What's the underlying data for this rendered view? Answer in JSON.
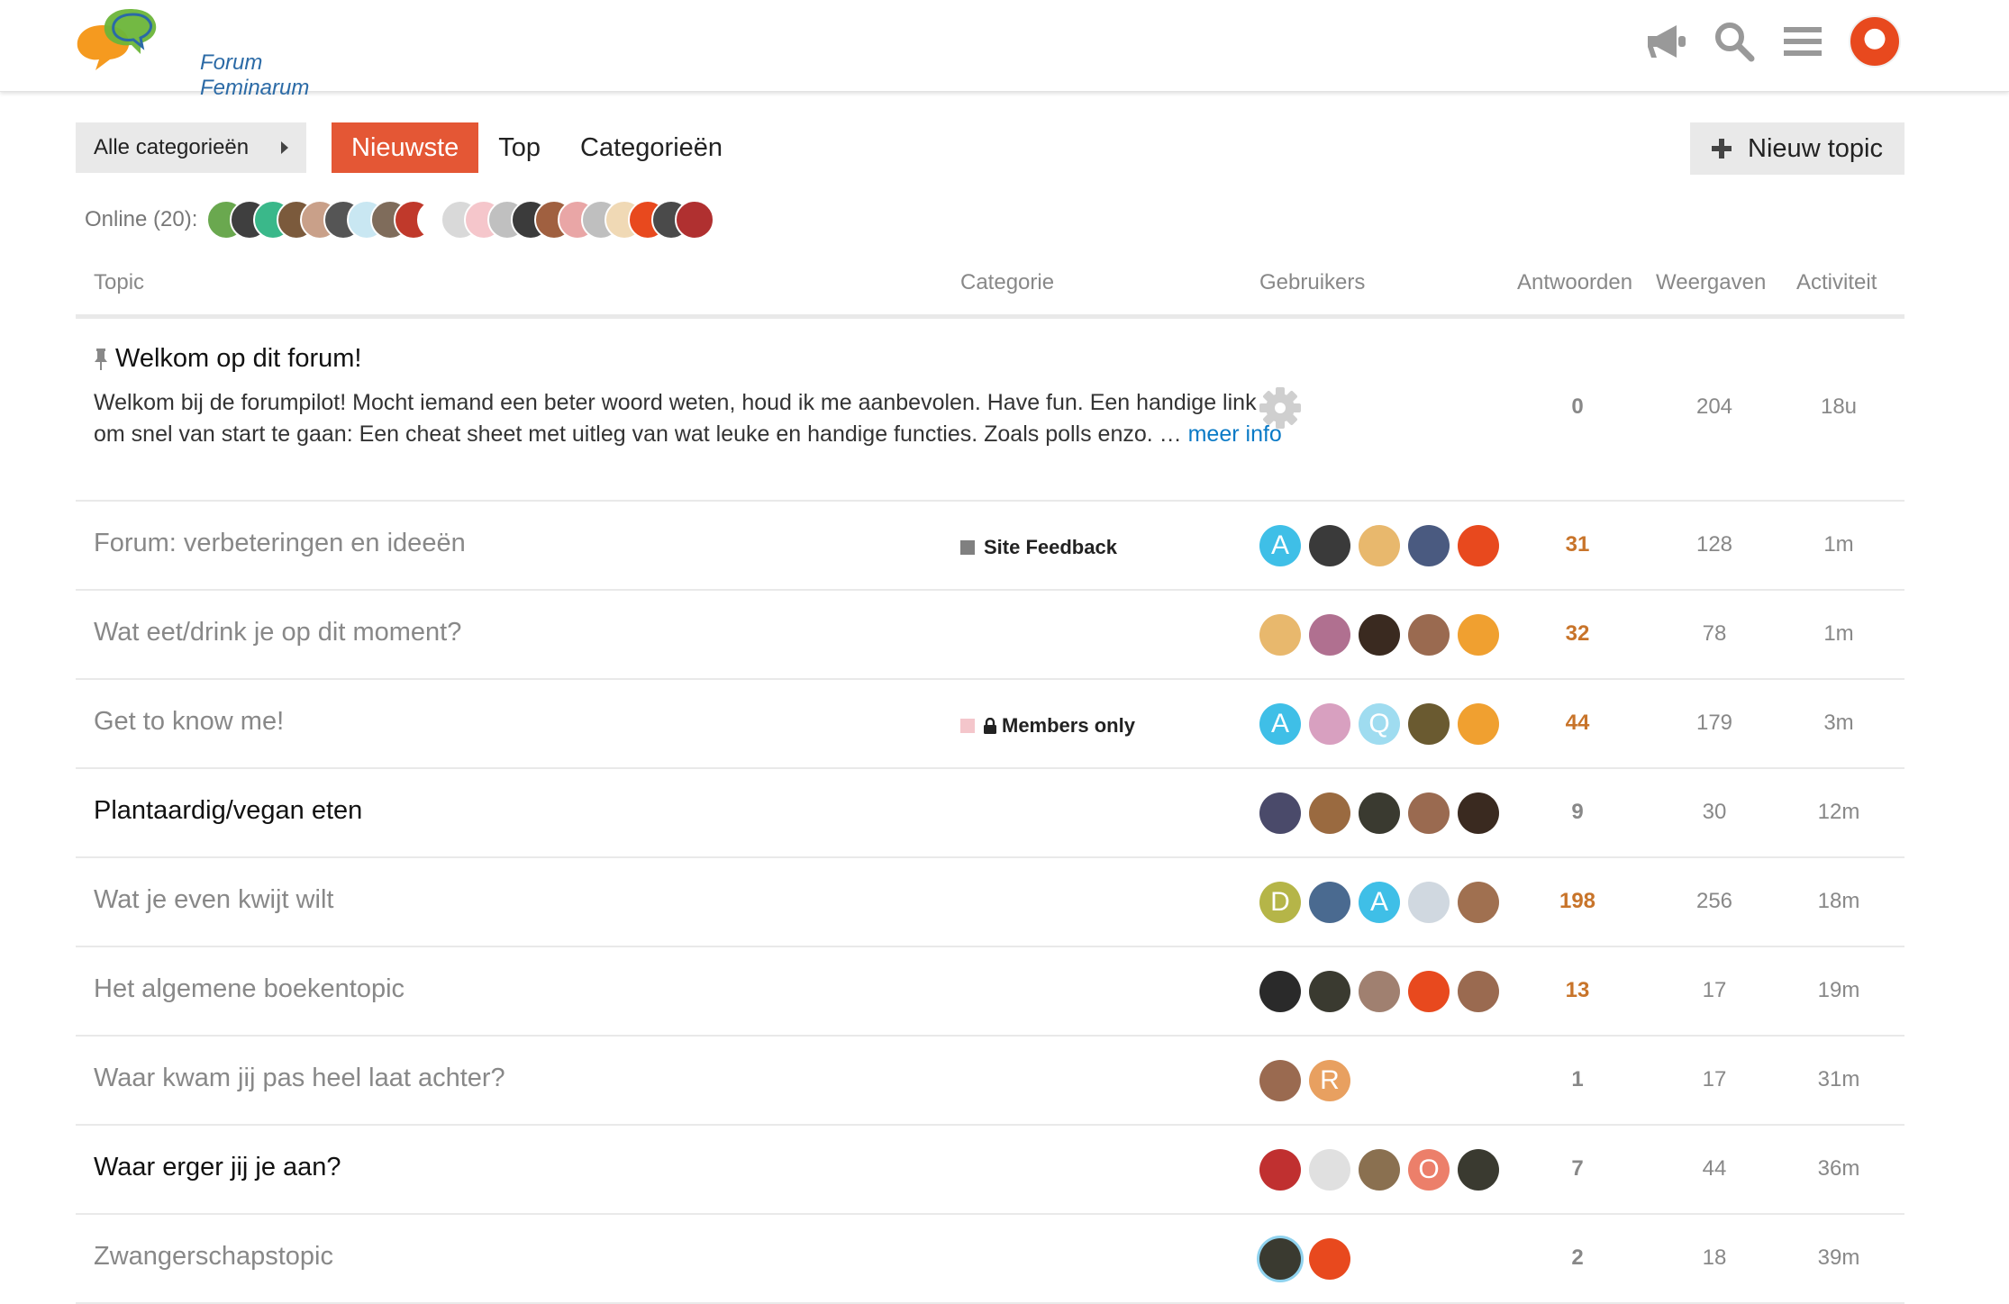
{
  "app": {
    "logo_text": "Forum Feminarum"
  },
  "header_icons": [
    "megaphone-icon",
    "search-icon",
    "hamburger-icon",
    "user-avatar"
  ],
  "nav": {
    "category_dropdown": "Alle categorieën",
    "tabs": [
      {
        "label": "Nieuwste",
        "active": true
      },
      {
        "label": "Top",
        "active": false
      },
      {
        "label": "Categorieën",
        "active": false
      }
    ],
    "new_topic_label": "Nieuw topic"
  },
  "online": {
    "label": "Online (20):",
    "avatar_colors": [
      "#6aa84f",
      "#3f3f3f",
      "#3ab88a",
      "#7b5a3c",
      "#c9a089",
      "#555555",
      "#c9e7f2",
      "#7f6c5b",
      "#c0392b",
      "#ffffff",
      "#d9d9d9",
      "#f5c6cb",
      "#c0c0c0",
      "#3b3b3b",
      "#a06040",
      "#e9a6a6",
      "#bfbfbf",
      "#f0d9b5",
      "#e8491e",
      "#4a4a4a",
      "#b03030"
    ]
  },
  "table": {
    "headers": {
      "topic": "Topic",
      "category": "Categorie",
      "users": "Gebruikers",
      "replies": "Antwoorden",
      "views": "Weergaven",
      "activity": "Activiteit"
    },
    "pinned": {
      "title": "Welkom op dit forum!",
      "excerpt": "Welkom bij de forumpilot! Mocht iemand een beter woord weten, houd ik me aanbevolen. Have fun. Een handige link om snel van start te gaan: Een cheat sheet met uitleg van wat leuke en handige functies. Zoals polls enzo. … ",
      "more_link": "meer info",
      "replies": "0",
      "views": "204",
      "activity": "18u"
    },
    "rows": [
      {
        "title": "Forum: verbeteringen en ideeën",
        "unread": false,
        "category": "Site Feedback",
        "category_color": "#808080",
        "locked": false,
        "users": [
          {
            "letter": "A",
            "color": "#3fbfe7"
          },
          {
            "letter": "",
            "color": "#3a3a3a"
          },
          {
            "letter": "",
            "color": "#e8b86d"
          },
          {
            "letter": "",
            "color": "#4a5a80"
          },
          {
            "letter": "",
            "color": "#e8491e"
          }
        ],
        "replies": "31",
        "hot": true,
        "views": "128",
        "activity": "1m"
      },
      {
        "title": "Wat eet/drink je op dit moment?",
        "unread": false,
        "category": "",
        "category_color": "",
        "locked": false,
        "users": [
          {
            "letter": "",
            "color": "#e8b86d"
          },
          {
            "letter": "",
            "color": "#b07090"
          },
          {
            "letter": "",
            "color": "#3a2a20"
          },
          {
            "letter": "",
            "color": "#9a6a50"
          },
          {
            "letter": "",
            "color": "#f0a030"
          }
        ],
        "replies": "32",
        "hot": true,
        "views": "78",
        "activity": "1m"
      },
      {
        "title": "Get to know me!",
        "unread": false,
        "category": "Members only",
        "category_color": "#f4c6cb",
        "locked": true,
        "users": [
          {
            "letter": "A",
            "color": "#3fbfe7"
          },
          {
            "letter": "",
            "color": "#d8a0c0"
          },
          {
            "letter": "Q",
            "color": "#9fdcf0"
          },
          {
            "letter": "",
            "color": "#6a5a30"
          },
          {
            "letter": "",
            "color": "#f0a030"
          }
        ],
        "replies": "44",
        "hot": true,
        "views": "179",
        "activity": "3m"
      },
      {
        "title": "Plantaardig/vegan eten",
        "unread": true,
        "category": "",
        "category_color": "",
        "locked": false,
        "users": [
          {
            "letter": "",
            "color": "#4a4a6a"
          },
          {
            "letter": "",
            "color": "#9a6a40"
          },
          {
            "letter": "",
            "color": "#3a3a30"
          },
          {
            "letter": "",
            "color": "#9a6a50"
          },
          {
            "letter": "",
            "color": "#3a2a20"
          }
        ],
        "replies": "9",
        "hot": false,
        "views": "30",
        "activity": "12m"
      },
      {
        "title": "Wat je even kwijt wilt",
        "unread": false,
        "category": "",
        "category_color": "",
        "locked": false,
        "users": [
          {
            "letter": "D",
            "color": "#b5b548"
          },
          {
            "letter": "",
            "color": "#4a6a90"
          },
          {
            "letter": "A",
            "color": "#3fbfe7"
          },
          {
            "letter": "",
            "color": "#d0d8e0"
          },
          {
            "letter": "",
            "color": "#a07050"
          }
        ],
        "replies": "198",
        "hot": true,
        "views": "256",
        "activity": "18m"
      },
      {
        "title": "Het algemene boekentopic",
        "unread": false,
        "category": "",
        "category_color": "",
        "locked": false,
        "users": [
          {
            "letter": "",
            "color": "#2a2a2a"
          },
          {
            "letter": "",
            "color": "#3a3a30"
          },
          {
            "letter": "",
            "color": "#a08070"
          },
          {
            "letter": "",
            "color": "#e8491e"
          },
          {
            "letter": "",
            "color": "#9a6a50"
          }
        ],
        "replies": "13",
        "hot": true,
        "views": "17",
        "activity": "19m"
      },
      {
        "title": "Waar kwam jij pas heel laat achter?",
        "unread": false,
        "category": "",
        "category_color": "",
        "locked": false,
        "users": [
          {
            "letter": "",
            "color": "#9a6a50"
          },
          {
            "letter": "R",
            "color": "#e8a060"
          }
        ],
        "replies": "1",
        "hot": false,
        "views": "17",
        "activity": "31m"
      },
      {
        "title": "Waar erger jij je aan?",
        "unread": true,
        "category": "",
        "category_color": "",
        "locked": false,
        "users": [
          {
            "letter": "",
            "color": "#c03030"
          },
          {
            "letter": "",
            "color": "#e0e0e0"
          },
          {
            "letter": "",
            "color": "#8a7050"
          },
          {
            "letter": "O",
            "color": "#ec7f6a"
          },
          {
            "letter": "",
            "color": "#3a3a30"
          }
        ],
        "replies": "7",
        "hot": false,
        "views": "44",
        "activity": "36m"
      },
      {
        "title": "Zwangerschapstopic",
        "unread": false,
        "category": "",
        "category_color": "",
        "locked": false,
        "users": [
          {
            "letter": "",
            "color": "#3a3a30",
            "ring": true
          },
          {
            "letter": "",
            "color": "#e8491e"
          }
        ],
        "replies": "2",
        "hot": false,
        "views": "18",
        "activity": "39m"
      }
    ]
  },
  "colors": {
    "accent": "#e45735",
    "hot_reply": "#c8742a",
    "link": "#0a7ac6"
  }
}
